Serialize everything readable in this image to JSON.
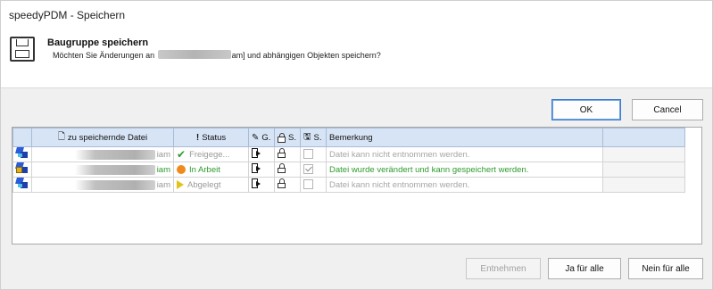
{
  "window": {
    "title": "speedyPDM - Speichern"
  },
  "header": {
    "title": "Baugruppe speichern",
    "message_prefix": "Möchten Sie Änderungen an",
    "message_suffix": "am] und abhängigen Objekten speichern?",
    "icon": "save-icon"
  },
  "buttons": {
    "ok": "OK",
    "cancel": "Cancel",
    "entnehmen": "Entnehmen",
    "ja_fuer_alle": "Ja für alle",
    "nein_fuer_alle": "Nein für alle"
  },
  "table": {
    "headers": {
      "file": "zu speichernde Datei",
      "status": "Status",
      "g": "G.",
      "s": "S.",
      "s2": "S.",
      "remark": "Bemerkung"
    },
    "rows": [
      {
        "ext": "iam",
        "status": "Freigege...",
        "status_icon": "checkmark-icon",
        "checked": false,
        "remark": "Datei kann nicht entnommen werden."
      },
      {
        "ext": "iam",
        "status": "In Arbeit",
        "status_icon": "orange-dot-icon",
        "checked": true,
        "remark": "Datei wurde verändert und kann gespeichert werden."
      },
      {
        "ext": "iam",
        "status": "Abgelegt",
        "status_icon": "yellow-triangle-icon",
        "checked": false,
        "remark": "Datei kann nicht entnommen werden."
      }
    ]
  },
  "colors": {
    "header_bg": "#d6e4f5",
    "status_green": "#2e9b2e",
    "status_orange": "#f08a1c",
    "status_yellow": "#e3c21a",
    "primary_border": "#3c7fd1"
  }
}
